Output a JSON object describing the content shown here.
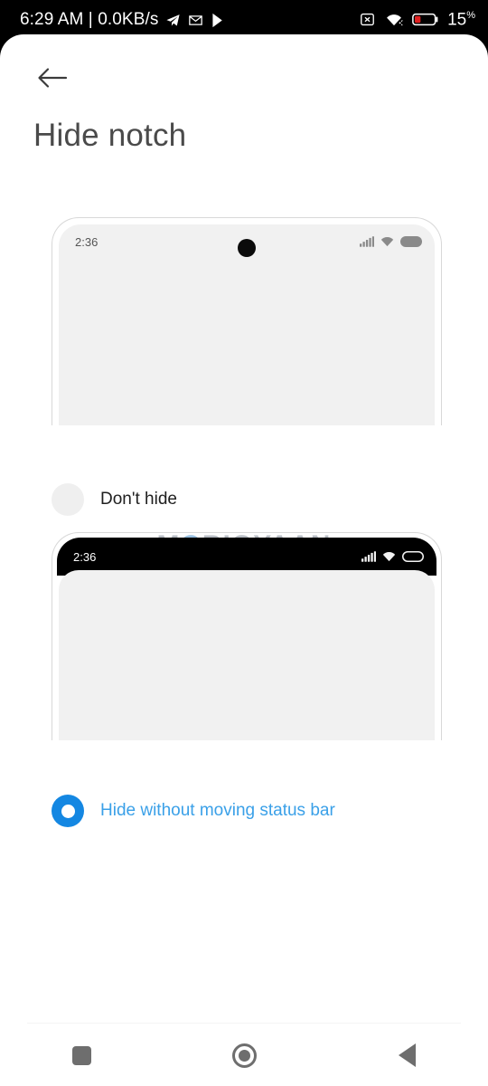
{
  "device_status_bar": {
    "clock": "6:29 AM | 0.0KB/s",
    "left_icons": [
      "telegram-icon",
      "gmail-icon",
      "play-store-icon"
    ],
    "right_icons": [
      "no-sim-icon",
      "wifi-icon",
      "battery-low-icon"
    ],
    "battery_percent": "15",
    "battery_percent_suffix": "%",
    "battery_color": "#e02020",
    "background": "#000000",
    "text_color": "#ffffff"
  },
  "header": {
    "back_icon": "back-arrow-icon",
    "title": "Hide notch"
  },
  "previews": [
    {
      "id": "dont-hide",
      "mini_clock": "2:36",
      "has_camera_dot": true,
      "status_bar_style": "light",
      "icons": [
        "signal-bars-icon",
        "wifi-icon",
        "battery-icon"
      ]
    },
    {
      "id": "hide",
      "mini_clock": "2:36",
      "has_camera_dot": false,
      "status_bar_style": "black",
      "icons": [
        "signal-bars-icon",
        "wifi-icon",
        "battery-icon"
      ]
    }
  ],
  "options": [
    {
      "id": "dont-hide",
      "label": "Don't hide",
      "selected": false
    },
    {
      "id": "hide-without-moving",
      "label": "Hide without moving status bar",
      "selected": true
    }
  ],
  "accent_color": "#1487e2",
  "selected_label_color": "#3aa0e8",
  "watermark": {
    "part1": "M",
    "part2": "O",
    "part3": "BIGYAAN",
    "full": "MOBIGYAAN"
  },
  "nav_bar": {
    "recents_icon": "square-recents-icon",
    "home_icon": "circle-home-icon",
    "back_icon": "triangle-back-icon"
  }
}
